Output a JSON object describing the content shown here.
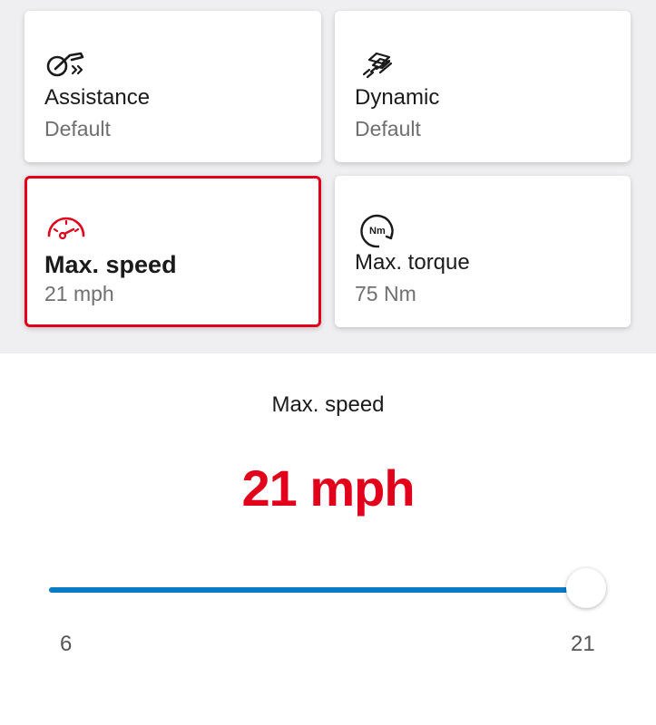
{
  "cards": [
    {
      "title": "Assistance",
      "value": "Default",
      "icon": "assistance-icon",
      "selected": false
    },
    {
      "title": "Dynamic",
      "value": "Default",
      "icon": "dynamic-icon",
      "selected": false
    },
    {
      "title": "Max. speed",
      "value": "21 mph",
      "icon": "speedometer-icon",
      "selected": true
    },
    {
      "title": "Max. torque",
      "value": "75 Nm",
      "icon": "torque-icon",
      "selected": false
    }
  ],
  "icon_labels": {
    "torque": "Nm"
  },
  "detail": {
    "label": "Max. speed",
    "value": "21 mph"
  },
  "slider": {
    "min": 6,
    "max": 21,
    "value": 21,
    "min_label": "6",
    "max_label": "21"
  },
  "colors": {
    "accent": "#e2001a",
    "slider": "#0a7bc4",
    "background": "#efeff1"
  }
}
